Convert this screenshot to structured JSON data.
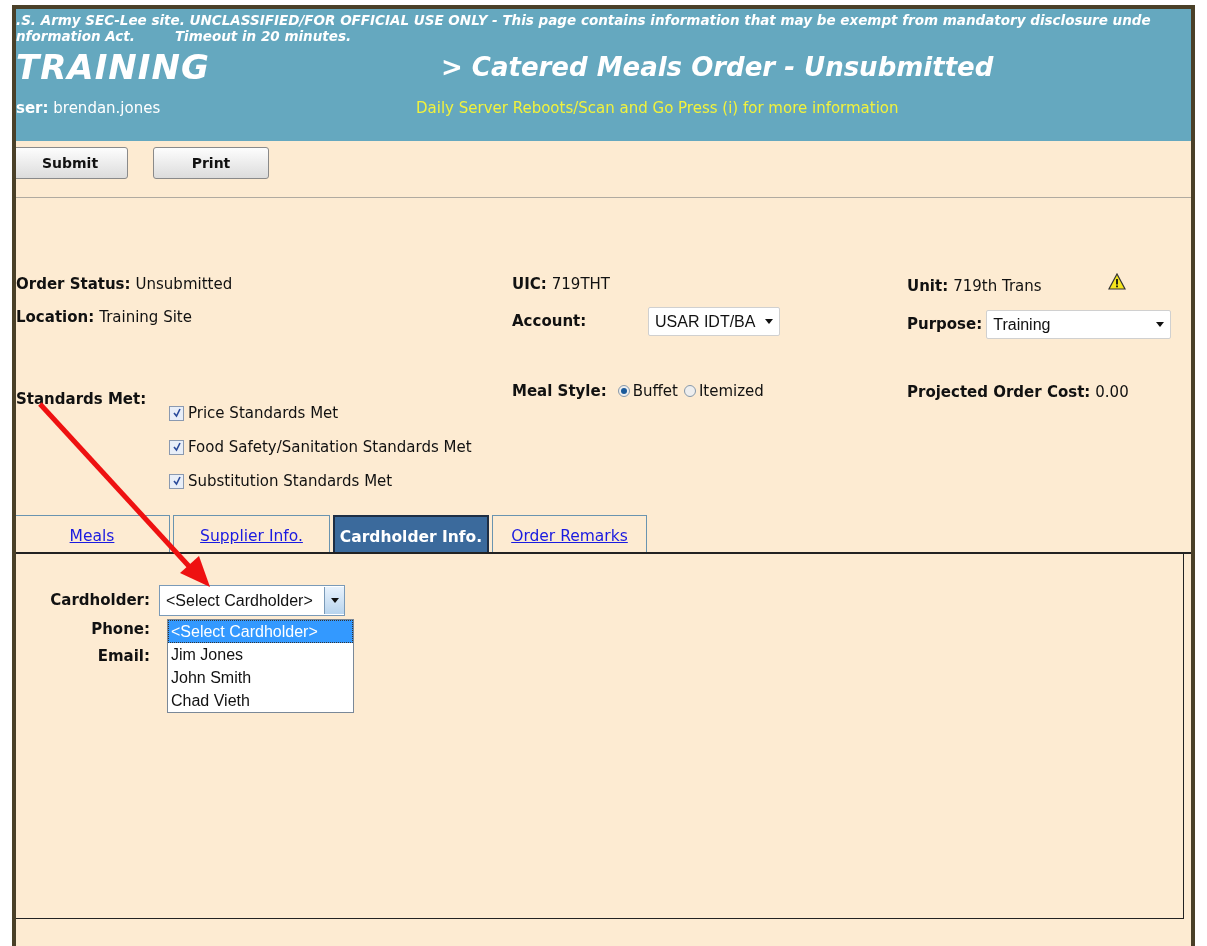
{
  "banner": {
    "notice": ".S. Army SEC-Lee site. UNCLASSIFIED/FOR OFFICIAL USE ONLY - This page contains information that may be exempt from mandatory disclosure unde",
    "notice_line2": "nformation Act.",
    "timeout": "Timeout in 20 minutes.",
    "environment": "TRAINING",
    "page_title": "> Catered Meals Order - Unsubmitted",
    "user_label": "ser:",
    "user_name": "brendan.jones",
    "announcement": "Daily Server Reboots/Scan and Go Press (i) for more information"
  },
  "toolbar": {
    "buttons": [
      "Submit",
      "Print"
    ]
  },
  "details": {
    "order_status": {
      "label": "Order Status:",
      "value": "Unsubmitted"
    },
    "location": {
      "label": "Location:",
      "value": "Training Site"
    },
    "uic": {
      "label": "UIC:",
      "value": "719THT"
    },
    "account": {
      "label": "Account:",
      "value": "USAR IDT/BA"
    },
    "unit": {
      "label": "Unit:",
      "value": "719th Trans",
      "warning": true
    },
    "purpose": {
      "label": "Purpose:",
      "value": "Training"
    },
    "standards": {
      "label": "Standards Met:",
      "items": [
        {
          "label": "Price Standards Met",
          "checked": true
        },
        {
          "label": "Food Safety/Sanitation Standards Met",
          "checked": true
        },
        {
          "label": "Substitution Standards Met",
          "checked": true
        }
      ]
    },
    "meal_style": {
      "label": "Meal Style:",
      "options": [
        {
          "label": "Buffet",
          "selected": true
        },
        {
          "label": "Itemized",
          "selected": false
        }
      ]
    },
    "projected_cost": {
      "label": "Projected Order Cost:",
      "value": "0.00"
    }
  },
  "tabs": [
    {
      "label": "Meals",
      "selected": false
    },
    {
      "label": "Supplier Info.",
      "selected": false
    },
    {
      "label": "Cardholder Info.",
      "selected": true
    },
    {
      "label": "Order Remarks",
      "selected": false
    }
  ],
  "cardholder": {
    "label": "Cardholder:",
    "value": "<Select Cardholder>",
    "phone_label": "Phone:",
    "email_label": "Email:",
    "options": [
      {
        "label": "<Select Cardholder>",
        "selected": true
      },
      {
        "label": "Jim Jones",
        "selected": false
      },
      {
        "label": "John Smith",
        "selected": false
      },
      {
        "label": "Chad Vieth",
        "selected": false
      }
    ]
  }
}
